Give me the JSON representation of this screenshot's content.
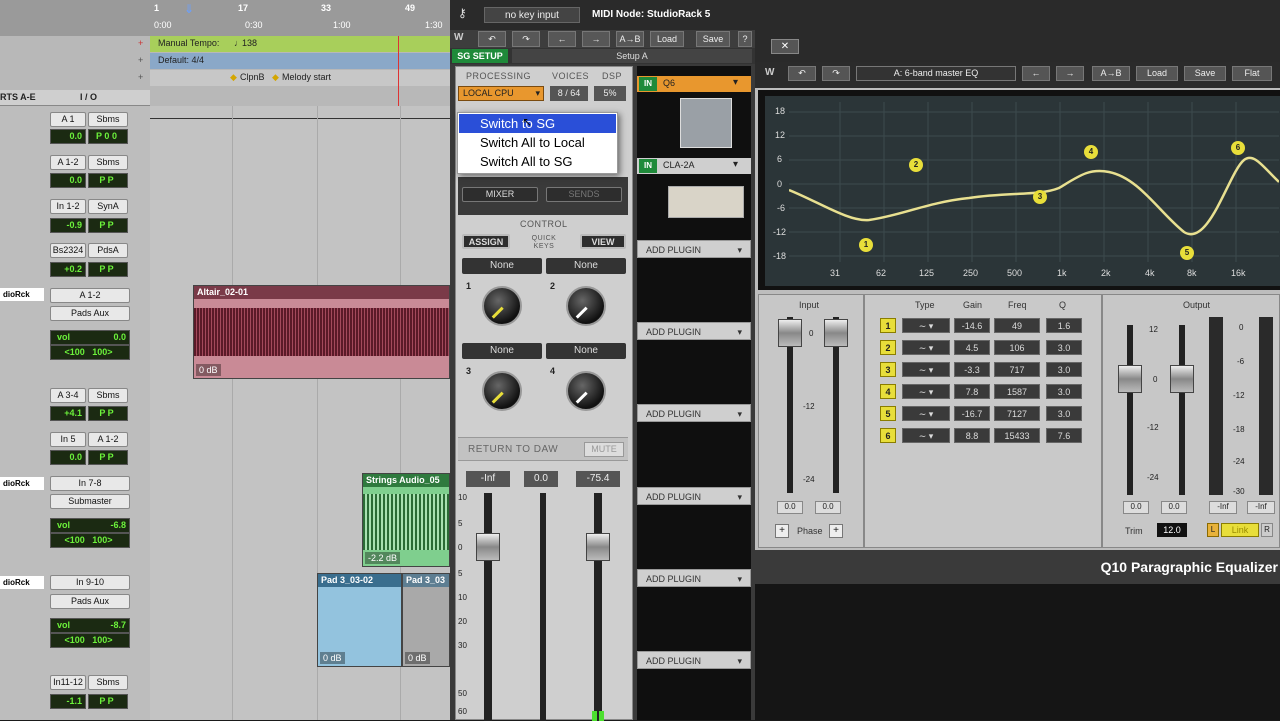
{
  "protools": {
    "ruler": {
      "bars": [
        "1",
        "17",
        "33",
        "49"
      ],
      "timecodes": [
        "0:00",
        "0:30",
        "1:00",
        "1:30"
      ]
    },
    "rows": {
      "tempo": "Manual Tempo:",
      "tempo_val": "138",
      "meter": "Default: 4/4",
      "markers": "ClpnB",
      "marker2": "Melody start"
    },
    "col_left": "RTS A-E",
    "col_io": "I / O",
    "tracks": [
      {
        "in": "A 1",
        "out": "Sbms",
        "vol": "0.0",
        "p1": "P",
        "p2": "0",
        "p3": "0"
      },
      {
        "in": "A 1-2",
        "out": "Sbms",
        "vol": "0.0",
        "p1": "P",
        "p2": "P"
      },
      {
        "in": "In 1-2",
        "out": "SynA",
        "vol": "-0.9",
        "p1": "P",
        "p2": "P"
      },
      {
        "in": "Bs2324",
        "out": "PdsA",
        "vol": "+0.2",
        "p1": "P",
        "p2": "P"
      }
    ],
    "rack1": {
      "label": "dioRck",
      "io": "A 1-2",
      "aux": "Pads Aux",
      "vol_lbl": "vol",
      "vol": "0.0",
      "pan_l": "<100",
      "pan_r": "100>"
    },
    "tracks2": [
      {
        "in": "A 3-4",
        "out": "Sbms",
        "vol": "+4.1",
        "p1": "P",
        "p2": "P"
      },
      {
        "in": "In 5",
        "out": "A 1-2",
        "vol": "0.0",
        "p1": "P",
        "p2": "P"
      }
    ],
    "rack2": {
      "label": "dioRck",
      "io": "In 7-8",
      "aux": "Submaster",
      "vol_lbl": "vol",
      "vol": "-6.8",
      "pan_l": "<100",
      "pan_r": "100>"
    },
    "rack3": {
      "label": "dioRck",
      "io": "In 9-10",
      "aux": "Pads Aux",
      "vol_lbl": "vol",
      "vol": "-8.7",
      "pan_l": "<100",
      "pan_r": "100>"
    },
    "track_last": {
      "in": "In11-12",
      "out": "Sbms",
      "vol": "-1.1",
      "p1": "P",
      "p2": "P"
    },
    "clips": [
      {
        "name": "Altair_02-01",
        "db": "0 dB",
        "color": "#c98a96"
      },
      {
        "name": "Strings Audio_05",
        "db": "-2.2 dB",
        "color": "#7fcf8e"
      },
      {
        "name": "Pad 3_03-02",
        "db": "0 dB",
        "color": "#93c3de"
      },
      {
        "name": "Pad 3_03",
        "db": "0 dB",
        "color": "#a9a9a9"
      }
    ]
  },
  "studiorack": {
    "key_input": "no key input",
    "node": "MIDI Node: StudioRack 5",
    "toolbar": {
      "load": "Load",
      "save": "Save",
      "help": "?",
      "ab": "A→B",
      "sg_setup": "SG SETUP",
      "setup": "Setup A"
    },
    "processing_lbl": "PROCESSING",
    "voices_lbl": "VOICES",
    "dsp_lbl": "DSP",
    "processing_val": "LOCAL CPU",
    "voices_val": "8 / 64",
    "dsp_val": "5%",
    "menu": [
      "Switch to SG",
      "Switch All to Local",
      "Switch All to SG"
    ],
    "mixer": "MIXER",
    "sends": "SENDS",
    "control": "CONTROL",
    "assign": "ASSIGN",
    "quick_keys": "QUICK KEYS",
    "view": "VIEW",
    "knobs": [
      {
        "n": "1",
        "label": "None"
      },
      {
        "n": "2",
        "label": "None"
      },
      {
        "n": "3",
        "label": "None"
      },
      {
        "n": "4",
        "label": "None"
      }
    ],
    "return": "RETURN TO DAW",
    "mute": "MUTE",
    "meters": {
      "a": "-Inf",
      "b": "0.0",
      "c": "-75.4"
    },
    "scale": [
      "10",
      "5",
      "0",
      "5",
      "10",
      "20",
      "30",
      "50",
      "60"
    ],
    "plugins": [
      {
        "in": "IN",
        "name": "Q6"
      },
      {
        "in": "IN",
        "name": "CLA-2A"
      }
    ],
    "add_plugin": "ADD PLUGIN"
  },
  "q10": {
    "close": "✕",
    "preset": "A: 6-band master EQ",
    "buttons": {
      "ab": "A→B",
      "load": "Load",
      "save": "Save",
      "flat": "Flat"
    },
    "y_ticks": [
      "18",
      "12",
      "6",
      "0",
      "-6",
      "-12",
      "-18"
    ],
    "x_ticks": [
      "31",
      "62",
      "125",
      "250",
      "500",
      "1k",
      "2k",
      "4k",
      "8k",
      "16k"
    ],
    "input_lbl": "Input",
    "output_lbl": "Output",
    "headers": {
      "type": "Type",
      "gain": "Gain",
      "freq": "Freq",
      "q": "Q"
    },
    "bands": [
      {
        "n": "1",
        "gain": "-14.6",
        "freq": "49",
        "q": "1.6"
      },
      {
        "n": "2",
        "gain": "4.5",
        "freq": "106",
        "q": "3.0"
      },
      {
        "n": "3",
        "gain": "-3.3",
        "freq": "717",
        "q": "3.0"
      },
      {
        "n": "4",
        "gain": "7.8",
        "freq": "1587",
        "q": "3.0"
      },
      {
        "n": "5",
        "gain": "-16.7",
        "freq": "7127",
        "q": "3.0"
      },
      {
        "n": "6",
        "gain": "8.8",
        "freq": "15433",
        "q": "7.6"
      }
    ],
    "in_vals": [
      "0.0",
      "0.0"
    ],
    "out_vals": [
      "-Inf",
      "-Inf"
    ],
    "phase": "Phase",
    "trim": "Trim",
    "trim_val": "12.0",
    "link": "Link",
    "scale_in": [
      "0",
      "-12",
      "-24"
    ],
    "scale_out": [
      "12",
      "0",
      "-12",
      "-24"
    ],
    "scale_meter": [
      "0",
      "-6",
      "-12",
      "-18",
      "-24",
      "-30"
    ],
    "title": "Q10 Paragraphic Equalizer",
    "curve_points": [
      {
        "n": "1",
        "label": "1"
      },
      {
        "n": "2",
        "label": "2"
      },
      {
        "n": "3",
        "label": "3"
      },
      {
        "n": "4",
        "label": "4"
      },
      {
        "n": "5",
        "label": "5"
      },
      {
        "n": "6",
        "label": "6"
      }
    ]
  },
  "colors": {
    "lcd_green": "#6cf23b",
    "band_yellow": "#e8de3a",
    "tempo_bar": "#a8cf5b",
    "meter_bar": "#8aa8c8"
  }
}
